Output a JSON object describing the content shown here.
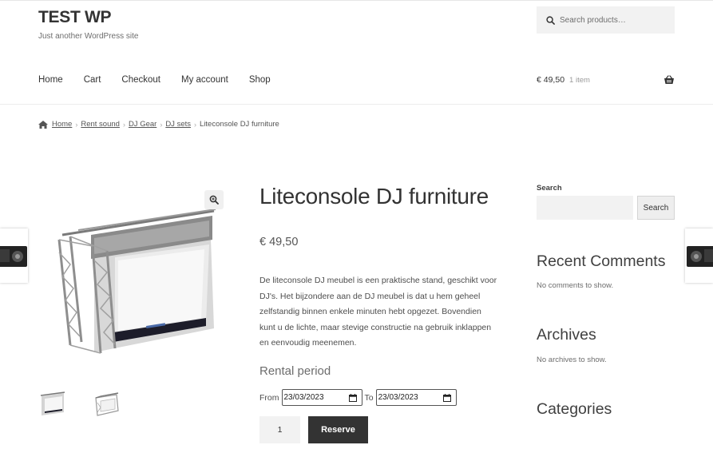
{
  "site": {
    "title": "TEST WP",
    "description": "Just another WordPress site"
  },
  "search": {
    "placeholder": "Search products…",
    "icon": "search-icon"
  },
  "nav": {
    "items": [
      {
        "label": "Home"
      },
      {
        "label": "Cart"
      },
      {
        "label": "Checkout"
      },
      {
        "label": "My account"
      },
      {
        "label": "Shop"
      }
    ]
  },
  "cart": {
    "amount": "€ 49,50",
    "count": "1 item",
    "icon": "basket-icon"
  },
  "breadcrumb": {
    "items": [
      {
        "label": "Home"
      },
      {
        "label": "Rent sound"
      },
      {
        "label": "DJ Gear"
      },
      {
        "label": "DJ sets"
      }
    ],
    "current": "Liteconsole DJ furniture"
  },
  "product": {
    "title": "Liteconsole DJ furniture",
    "price": "€ 49,50",
    "description": "De liteconsole DJ meubel is een praktische stand, geschikt voor DJ's. Het bijzondere aan de DJ meubel is dat u hem geheel zelfstandig binnen enkele minuten hebt opgezet. Bovendien kunt u de lichte, maar stevige constructie na gebruik inklappen en eenvoudig meenemen.",
    "rental": {
      "title": "Rental period",
      "from_label": "From",
      "from_value": "23/03/2023",
      "to_label": "To",
      "to_value": "23/03/2023"
    },
    "quantity": "1",
    "reserve_label": "Reserve"
  },
  "sidebar": {
    "search_label": "Search",
    "search_button": "Search",
    "recent_comments_title": "Recent Comments",
    "recent_comments_text": "No comments to show.",
    "archives_title": "Archives",
    "archives_text": "No archives to show.",
    "categories_title": "Categories"
  },
  "colors": {
    "text": "#333333",
    "muted": "#6d6d6d",
    "button_dark": "#333333",
    "field_bg": "#f2f2f2"
  }
}
